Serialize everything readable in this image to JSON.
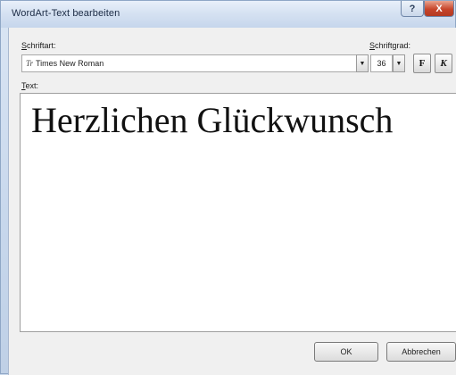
{
  "window": {
    "title": "WordArt-Text bearbeiten",
    "help_label": "?",
    "close_label": "X"
  },
  "font": {
    "label_accel": "S",
    "label_rest": "chriftart:",
    "value": "Times New Roman",
    "tt_glyph": "Tr",
    "dropdown_glyph": "▼"
  },
  "size": {
    "label_accel": "S",
    "label_rest": "chriftgrad:",
    "value": "36",
    "dropdown_glyph": "▼"
  },
  "format": {
    "bold_label": "F",
    "italic_label": "K"
  },
  "text": {
    "label_accel": "T",
    "label_rest": "ext:",
    "value": "Herzlichen Glückwunsch"
  },
  "buttons": {
    "ok": "OK",
    "cancel": "Abbrechen"
  }
}
